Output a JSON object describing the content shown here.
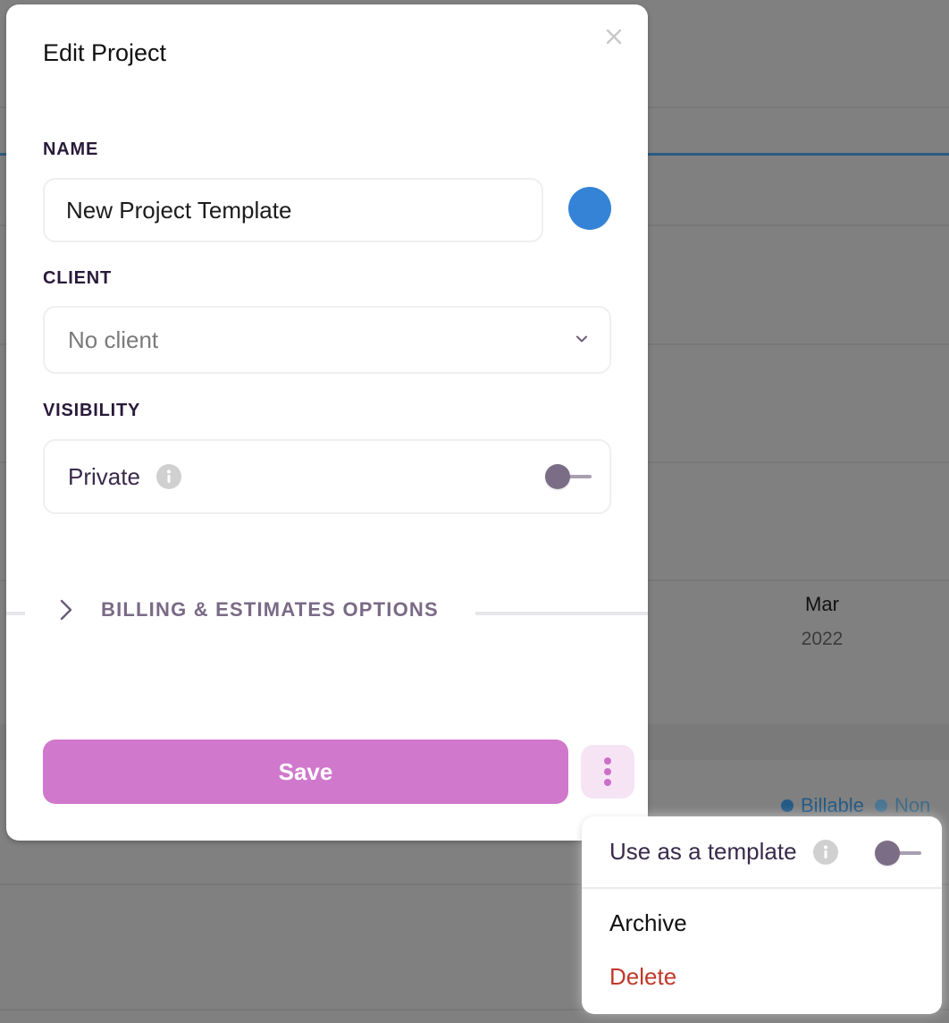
{
  "background": {
    "month_label": "Mar",
    "year_label": "2022",
    "legend": [
      {
        "label": "Billable",
        "color": "#245a86"
      },
      {
        "label": "Non",
        "color": "#4a7593"
      }
    ],
    "accent_color": "#2c5b82"
  },
  "modal": {
    "title": "Edit Project",
    "close_icon": "close-icon",
    "name": {
      "label": "NAME",
      "value": "New Project Template",
      "color": "#3583d6"
    },
    "client": {
      "label": "CLIENT",
      "selected": "No client"
    },
    "visibility": {
      "label": "VISIBILITY",
      "option_label": "Private",
      "toggle_on": false
    },
    "billing_section": {
      "label": "BILLING & ESTIMATES OPTIONS",
      "expanded": false
    },
    "save_label": "Save",
    "save_color": "#d078cc"
  },
  "more_menu": {
    "use_as_template_label": "Use as a template",
    "use_as_template_on": false,
    "archive_label": "Archive",
    "delete_label": "Delete",
    "delete_color": "#c0392b"
  }
}
